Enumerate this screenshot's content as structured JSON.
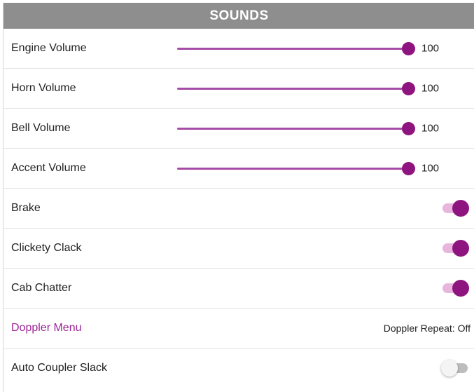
{
  "header": {
    "title": "SOUNDS"
  },
  "colors": {
    "accent": "#8e157f",
    "slider_fill": "#a64ca6",
    "header_bg": "#8e8e8e",
    "link": "#9b2494"
  },
  "sliders": [
    {
      "label": "Engine Volume",
      "value": "100",
      "level_percent": 100
    },
    {
      "label": "Horn Volume",
      "value": "100",
      "level_percent": 100
    },
    {
      "label": "Bell Volume",
      "value": "100",
      "level_percent": 100
    },
    {
      "label": "Accent Volume",
      "value": "100",
      "level_percent": 100
    }
  ],
  "toggles": [
    {
      "label": "Brake",
      "on": true
    },
    {
      "label": "Clickety Clack",
      "on": true
    },
    {
      "label": "Cab Chatter",
      "on": true
    }
  ],
  "doppler": {
    "menu_label": "Doppler Menu",
    "repeat_text": "Doppler Repeat: Off"
  },
  "auto_coupler": {
    "label": "Auto Coupler Slack",
    "on": false
  }
}
